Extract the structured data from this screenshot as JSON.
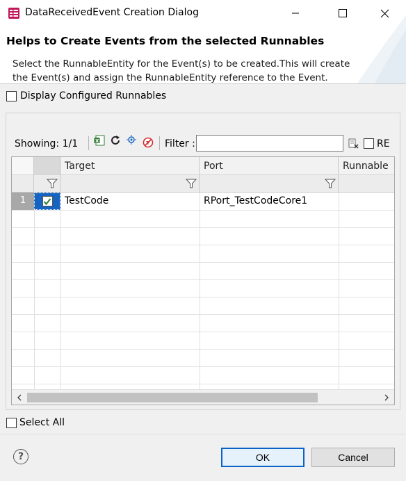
{
  "window": {
    "title": "DataReceivedEvent Creation Dialog"
  },
  "banner": {
    "title": "Helps to Create Events from the selected Runnables",
    "description": "Select the RunnableEntity for the Event(s) to be created.This will create the Event(s) and assign the RunnableEntity reference to the Event."
  },
  "options": {
    "display_configured": "Display Configured Runnables",
    "select_all": "Select All"
  },
  "toolbar": {
    "showing": "Showing: 1/1",
    "filter_label": "Filter :",
    "filter_value": "",
    "re_label": "RE"
  },
  "table": {
    "columns": [
      "Target",
      "Port",
      "Runnable"
    ],
    "rows": [
      {
        "index": "1",
        "checked": true,
        "target": "TestCode",
        "port": "RPort_TestCodeCore1",
        "runnable": ""
      }
    ]
  },
  "buttons": {
    "ok": "OK",
    "cancel": "Cancel",
    "help": "?"
  },
  "colors": {
    "selection": "#1565c0",
    "ok_border": "#0a64c8"
  }
}
